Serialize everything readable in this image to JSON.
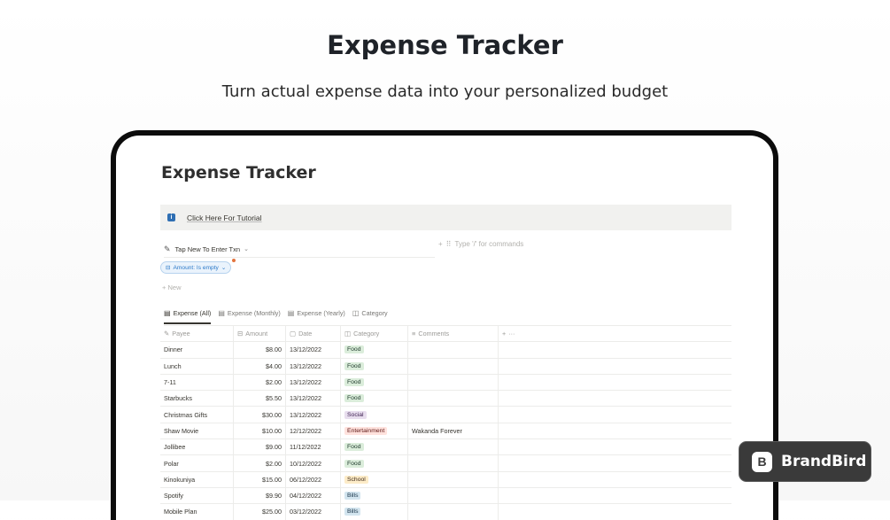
{
  "hero": {
    "title": "Expense Tracker",
    "subtitle": "Turn actual expense data into your personalized budget"
  },
  "page": {
    "title": "Expense Tracker",
    "callout": "Click Here For Tutorial",
    "button_block": "Tap New To Enter Txn",
    "type_placeholder": "Type '/' for commands",
    "filter_chip": "Amount: Is empty",
    "new_label": "New"
  },
  "views": [
    {
      "label": "Expense (All)"
    },
    {
      "label": "Expense (Monthly)"
    },
    {
      "label": "Expense (Yearly)"
    },
    {
      "label": "Category"
    }
  ],
  "columns": {
    "payee": "Payee",
    "amount": "Amount",
    "date": "Date",
    "category": "Category",
    "comments": "Comments"
  },
  "rows": [
    {
      "payee": "Dinner",
      "amount": "$8.00",
      "date": "13/12/2022",
      "category": "Food",
      "comments": ""
    },
    {
      "payee": "Lunch",
      "amount": "$4.00",
      "date": "13/12/2022",
      "category": "Food",
      "comments": ""
    },
    {
      "payee": "7-11",
      "amount": "$2.00",
      "date": "13/12/2022",
      "category": "Food",
      "comments": ""
    },
    {
      "payee": "Starbucks",
      "amount": "$5.50",
      "date": "13/12/2022",
      "category": "Food",
      "comments": ""
    },
    {
      "payee": "Christmas Gifts",
      "amount": "$30.00",
      "date": "13/12/2022",
      "category": "Social",
      "comments": ""
    },
    {
      "payee": "Shaw Movie",
      "amount": "$10.00",
      "date": "12/12/2022",
      "category": "Entertainment",
      "comments": "Wakanda Forever"
    },
    {
      "payee": "Jollibee",
      "amount": "$9.00",
      "date": "11/12/2022",
      "category": "Food",
      "comments": ""
    },
    {
      "payee": "Polar",
      "amount": "$2.00",
      "date": "10/12/2022",
      "category": "Food",
      "comments": ""
    },
    {
      "payee": "Kinokuniya",
      "amount": "$15.00",
      "date": "06/12/2022",
      "category": "School",
      "comments": ""
    },
    {
      "payee": "Spotify",
      "amount": "$9.90",
      "date": "04/12/2022",
      "category": "Bills",
      "comments": ""
    },
    {
      "payee": "Mobile Plan",
      "amount": "$25.00",
      "date": "03/12/2022",
      "category": "Bills",
      "comments": ""
    }
  ],
  "tag_colors": {
    "Food": {
      "bg": "#dbeddb",
      "fg": "#1c3829"
    },
    "Social": {
      "bg": "#e8deee",
      "fg": "#412454"
    },
    "Entertainment": {
      "bg": "#ffe2dd",
      "fg": "#5d1715"
    },
    "School": {
      "bg": "#fdecc8",
      "fg": "#402c1b"
    },
    "Bills": {
      "bg": "#d3e5ef",
      "fg": "#183347"
    }
  },
  "badge": {
    "text": "BrandBird",
    "logo_glyph": "B"
  }
}
